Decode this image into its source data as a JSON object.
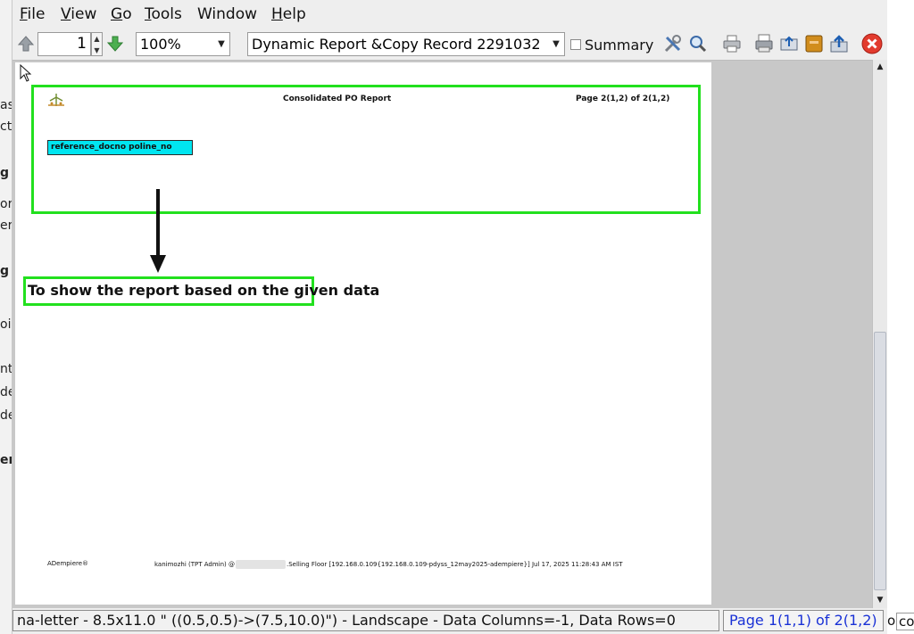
{
  "menubar": {
    "file": {
      "mnemonic": "F",
      "rest": "ile"
    },
    "view": {
      "mnemonic": "V",
      "rest": "iew"
    },
    "go": {
      "mnemonic": "G",
      "rest": "o"
    },
    "tools": {
      "mnemonic": "T",
      "rest": "ools"
    },
    "window": "Window",
    "help": {
      "mnemonic": "H",
      "rest": "elp"
    }
  },
  "toolbar": {
    "page_number": "1",
    "zoom": "100%",
    "report_selector": "Dynamic Report &Copy Record 2291032",
    "summary_label": "Summary",
    "summary_checked": false
  },
  "report": {
    "title": "Consolidated PO Report",
    "pager": "Page 2(1,2) of 2(1,2)",
    "column_header": "reference_docno  poline_no",
    "annotation": "To show the report based on the given data",
    "footer_left": "ADempiere®",
    "footer_user": "kanimozhi (TPT Admin) @",
    "footer_details": ".Selling Floor [192.168.0.109{192.168.0.109-pdyss_12may2025-adempiere}] Jul 17, 2025 11:28:43 AM IST"
  },
  "statusbar": {
    "info": "na-letter - 8.5x11.0 \" ((0.5,0.5)->(7.5,10.0)\") - Landscape - Data Columns=-1, Data Rows=0",
    "page_info": "Page 1(1,1) of 2(1,2)"
  },
  "background": {
    "fragments": [
      "as",
      "ct",
      "g",
      "or",
      "er",
      "g",
      "oi",
      "nt",
      "de",
      "de",
      "er"
    ],
    "right_fragments": [
      "o",
      "co"
    ]
  },
  "colors": {
    "highlight_green": "#22e01e",
    "column_header_bg": "#00e5f0",
    "page_info_text": "#1a32d6",
    "close_button": "#e23b2e"
  }
}
